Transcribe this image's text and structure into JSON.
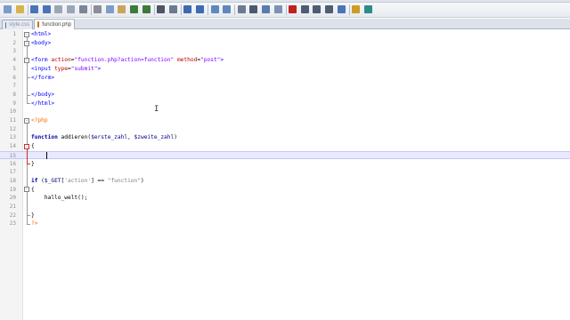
{
  "toolbar": {
    "buttons": [
      {
        "name": "new-file-icon",
        "color": "#7a9cc6"
      },
      {
        "name": "open-file-icon",
        "color": "#d8b24a"
      },
      {
        "name": "save-icon",
        "color": "#4a74b8"
      },
      {
        "name": "save-all-icon",
        "color": "#4a74b8"
      },
      {
        "name": "close-icon",
        "color": "#9aa6b8"
      },
      {
        "name": "close-all-icon",
        "color": "#9aa6b8"
      },
      {
        "name": "print-icon",
        "color": "#7b8696"
      },
      {
        "name": "cut-icon",
        "color": "#8a8f99"
      },
      {
        "name": "copy-icon",
        "color": "#7e9cc8"
      },
      {
        "name": "paste-icon",
        "color": "#c9a55a"
      },
      {
        "name": "undo-icon",
        "color": "#3b7c3b"
      },
      {
        "name": "redo-icon",
        "color": "#3b7c3b"
      },
      {
        "name": "find-icon",
        "color": "#4d5566"
      },
      {
        "name": "replace-icon",
        "color": "#6b7a92"
      },
      {
        "name": "zoom-in-icon",
        "color": "#3d6bb0"
      },
      {
        "name": "zoom-out-icon",
        "color": "#3d6bb0"
      },
      {
        "name": "sync-vertical-icon",
        "color": "#5f88c0"
      },
      {
        "name": "sync-horizontal-icon",
        "color": "#5f88c0"
      },
      {
        "name": "word-wrap-icon",
        "color": "#6d7b90"
      },
      {
        "name": "show-all-chars-icon",
        "color": "#4b5a70"
      },
      {
        "name": "indent-guide-icon",
        "color": "#5a7cb0"
      },
      {
        "name": "language-icon",
        "color": "#7c92b3"
      },
      {
        "name": "record-macro-icon",
        "color": "#c02020"
      },
      {
        "name": "stop-macro-icon",
        "color": "#4f5d72"
      },
      {
        "name": "play-macro-icon",
        "color": "#4f5d72"
      },
      {
        "name": "play-multiple-icon",
        "color": "#4f5d72"
      },
      {
        "name": "save-macro-icon",
        "color": "#4a74b8"
      },
      {
        "name": "run-icon",
        "color": "#d09a28"
      },
      {
        "name": "filter-icon",
        "color": "#2f8a8a"
      }
    ]
  },
  "tabs": [
    {
      "label": "style.css",
      "active": false,
      "icon": "css-file-icon",
      "color": "#4a74b8"
    },
    {
      "label": "function.php",
      "active": true,
      "icon": "php-file-icon",
      "color": "#d26a1e"
    }
  ],
  "editor": {
    "current_line": 15,
    "lines": [
      {
        "n": "1",
        "tokens": [
          {
            "t": "<html>",
            "c": "tag"
          }
        ]
      },
      {
        "n": "2",
        "tokens": [
          {
            "t": "<body>",
            "c": "tag"
          }
        ]
      },
      {
        "n": "3",
        "tokens": []
      },
      {
        "n": "4",
        "tokens": [
          {
            "t": "<form ",
            "c": "tag"
          },
          {
            "t": "action",
            "c": "attr"
          },
          {
            "t": "=",
            "c": "op"
          },
          {
            "t": "\"function.php?action=function\"",
            "c": "str"
          },
          {
            "t": " ",
            "c": "op"
          },
          {
            "t": "method",
            "c": "attr"
          },
          {
            "t": "=",
            "c": "op"
          },
          {
            "t": "\"post\"",
            "c": "str"
          },
          {
            "t": ">",
            "c": "tag"
          }
        ]
      },
      {
        "n": "5",
        "tokens": [
          {
            "t": "<input ",
            "c": "tag"
          },
          {
            "t": "type",
            "c": "attr"
          },
          {
            "t": "=",
            "c": "op"
          },
          {
            "t": "\"submit\"",
            "c": "str"
          },
          {
            "t": ">",
            "c": "tag"
          }
        ]
      },
      {
        "n": "6",
        "tokens": [
          {
            "t": "</form>",
            "c": "tag"
          }
        ]
      },
      {
        "n": "7",
        "tokens": []
      },
      {
        "n": "8",
        "tokens": [
          {
            "t": "</body>",
            "c": "tag"
          }
        ]
      },
      {
        "n": "9",
        "tokens": [
          {
            "t": "</html>",
            "c": "tag"
          }
        ]
      },
      {
        "n": "10",
        "tokens": []
      },
      {
        "n": "11",
        "tokens": [
          {
            "t": "<?php",
            "c": "php"
          }
        ]
      },
      {
        "n": "12",
        "tokens": []
      },
      {
        "n": "13",
        "tokens": [
          {
            "t": "function",
            "c": "kw"
          },
          {
            "t": " addieren",
            "c": "op"
          },
          {
            "t": "(",
            "c": "op"
          },
          {
            "t": "$erste_zahl",
            "c": "var"
          },
          {
            "t": ", ",
            "c": "op"
          },
          {
            "t": "$zweite_zahl",
            "c": "var"
          },
          {
            "t": ")",
            "c": "op"
          }
        ]
      },
      {
        "n": "14",
        "tokens": [
          {
            "t": "{",
            "c": "op"
          }
        ]
      },
      {
        "n": "15",
        "tokens": [
          {
            "t": "    ",
            "c": "op"
          }
        ]
      },
      {
        "n": "16",
        "tokens": [
          {
            "t": "}",
            "c": "op"
          }
        ]
      },
      {
        "n": "17",
        "tokens": []
      },
      {
        "n": "18",
        "tokens": [
          {
            "t": "if",
            "c": "kw"
          },
          {
            "t": " (",
            "c": "op"
          },
          {
            "t": "$_GET",
            "c": "var"
          },
          {
            "t": "[",
            "c": "op"
          },
          {
            "t": "'action'",
            "c": "phpstr"
          },
          {
            "t": "]",
            "c": "op"
          },
          {
            "t": " == ",
            "c": "op"
          },
          {
            "t": "\"function\"",
            "c": "phpstr"
          },
          {
            "t": ")",
            "c": "op"
          }
        ]
      },
      {
        "n": "19",
        "tokens": [
          {
            "t": "{",
            "c": "op"
          }
        ]
      },
      {
        "n": "20",
        "tokens": [
          {
            "t": "    hallo_welt",
            "c": "op"
          },
          {
            "t": "();",
            "c": "op"
          }
        ]
      },
      {
        "n": "21",
        "tokens": []
      },
      {
        "n": "22",
        "tokens": [
          {
            "t": "}",
            "c": "op"
          }
        ]
      },
      {
        "n": "23",
        "tokens": [
          {
            "t": "?>",
            "c": "php"
          }
        ]
      }
    ]
  },
  "colors": {
    "tag": "#0000ff",
    "attr": "#c00000",
    "str": "#8000ff",
    "php": "#ff6600",
    "keyword": "#0000a0",
    "current_line": "#e8e8ff"
  }
}
